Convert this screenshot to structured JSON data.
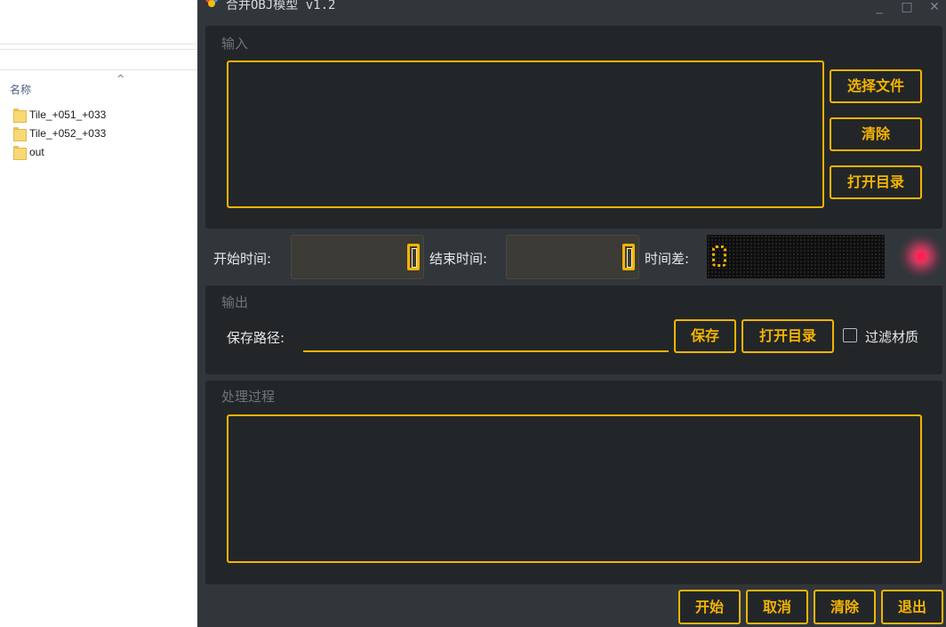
{
  "explorer": {
    "column_header": "名称",
    "items": [
      {
        "name": "Tile_+051_+033",
        "icon": "folder-icon"
      },
      {
        "name": "Tile_+052_+033",
        "icon": "folder-icon"
      },
      {
        "name": "out",
        "icon": "folder-icon"
      }
    ]
  },
  "window": {
    "title": "合并OBJ模型 v1.2",
    "controls": {
      "minimize": "_",
      "maximize": "□",
      "close": "✕"
    }
  },
  "input_panel": {
    "title": "输入",
    "select_file_button": "选择文件",
    "clear_button": "清除",
    "open_dir_button": "打开目录"
  },
  "timer": {
    "start_label": "开始时间:",
    "end_label": "结束时间:",
    "diff_label": "时间差:",
    "start_value": "0",
    "end_value": "0",
    "diff_value": "0"
  },
  "output_panel": {
    "title": "输出",
    "save_path_label": "保存路径:",
    "save_path_value": "",
    "save_button": "保存",
    "open_dir_button": "打开目录",
    "filter_material_label": "过滤材质",
    "filter_material_checked": false
  },
  "process_panel": {
    "title": "处理过程"
  },
  "footer": {
    "start_button": "开始",
    "cancel_button": "取消",
    "clear_button": "清除",
    "exit_button": "退出"
  },
  "colors": {
    "accent": "#f4b400",
    "window_bg": "#31363b",
    "panel_bg": "#232629",
    "led": "#ff2050"
  }
}
